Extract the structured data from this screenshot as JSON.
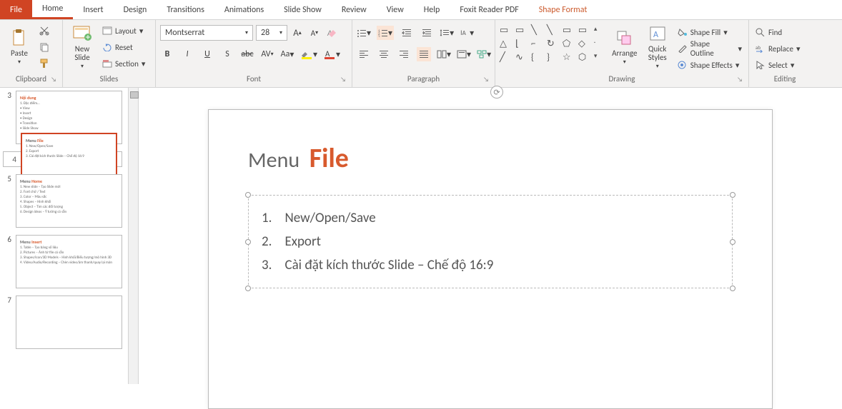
{
  "tabs": {
    "file": "File",
    "home": "Home",
    "insert": "Insert",
    "design": "Design",
    "transitions": "Transitions",
    "animations": "Animations",
    "slideshow": "Slide Show",
    "review": "Review",
    "view": "View",
    "help": "Help",
    "foxit": "Foxit Reader PDF",
    "shapefmt": "Shape Format"
  },
  "ribbon": {
    "clipboard": {
      "label": "Clipboard",
      "paste": "Paste"
    },
    "slides": {
      "label": "Slides",
      "newslide": "New\nSlide",
      "layout": "Layout",
      "reset": "Reset",
      "section": "Section"
    },
    "font": {
      "label": "Font",
      "name": "Montserrat",
      "size": "28",
      "bold": "B",
      "italic": "I",
      "underline": "U",
      "strike": "S",
      "shadow": "abc",
      "spacing": "AV",
      "case": "Aa"
    },
    "paragraph": {
      "label": "Paragraph"
    },
    "drawing": {
      "label": "Drawing",
      "arrange": "Arrange",
      "quickstyles": "Quick\nStyles",
      "fill": "Shape Fill",
      "outline": "Shape Outline",
      "effects": "Shape Effects"
    },
    "editing": {
      "label": "Editing",
      "find": "Find",
      "replace": "Replace",
      "select": "Select"
    }
  },
  "thumbs": [
    {
      "n": "3",
      "title": "Nội dung",
      "lines": [
        "1. Đặc điểm…",
        "• View",
        "• Insert",
        "• Design",
        "• Transition",
        "• Slide Show"
      ]
    },
    {
      "n": "4",
      "title": "Menu File",
      "lines": [
        "1. New/Open/Save",
        "2. Export",
        "3. Cài đặt kích thước Slide – Chế độ 16:9"
      ],
      "selected": true,
      "titlePrefix": "Menu"
    },
    {
      "n": "5",
      "title": "Menu Home",
      "lines": [
        "1. New slide – Tạo Slide mới",
        "2. Font chữ / Text",
        "3. Color – Màu sắc",
        "4. Shapes – Hình khối",
        "5. Object – Tìm các đối tượng",
        "6. Design ideas – Ý tưởng có sẵn"
      ],
      "titlePrefix": "Menu"
    },
    {
      "n": "6",
      "title": "Menu Insert",
      "lines": [
        "1. Table – Tạo bảng số liệu",
        "2. Pictures – Ảnh từ file có sẵn",
        "3. Shapes/Icon/3D Models – Hình khối/Biểu tượng/mô hình 3D",
        "4. Video/Audio/Recording – Chèn video/âm thanh/quay lại màn"
      ],
      "titlePrefix": "Menu"
    },
    {
      "n": "7",
      "title": "",
      "lines": []
    }
  ],
  "slide": {
    "titlePrefix": "Menu",
    "titleMain": "File",
    "items": [
      "New/Open/Save",
      "Export",
      "Cài đặt kích thước Slide – Chế độ 16:9"
    ]
  }
}
